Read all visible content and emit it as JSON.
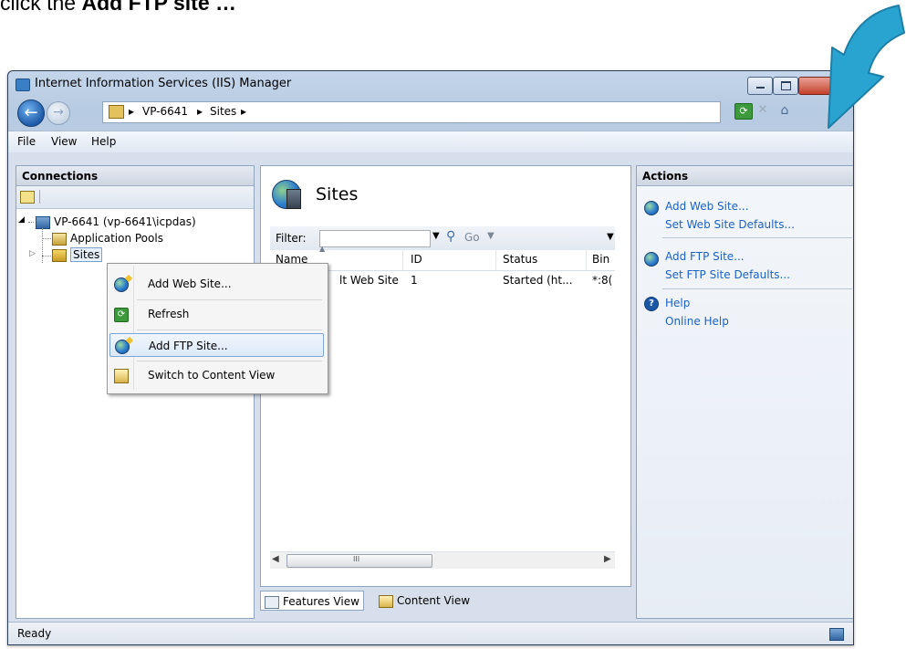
{
  "caption": {
    "prefix": "click the ",
    "bold": "Add FTP site …"
  },
  "window": {
    "title": "Internet Information Services (IIS) Manager"
  },
  "address": {
    "crumbs": [
      "VP-6641",
      "Sites"
    ],
    "sep": "▸"
  },
  "menu": {
    "file": "File",
    "view": "View",
    "help": "Help"
  },
  "connections": {
    "header": "Connections",
    "tree": {
      "server": "VP-6641 (vp-6641\\icpdas)",
      "pools": "Application Pools",
      "sites": "Sites"
    }
  },
  "center": {
    "title": "Sites",
    "filter_label": "Filter:",
    "go_label": "Go",
    "columns": [
      "Name",
      "ID",
      "Status",
      "Bin"
    ],
    "rows": [
      {
        "name": "Default Web Site",
        "visible_name": "lt Web Site",
        "id": "1",
        "status": "Started (ht...",
        "binding": "*:8("
      }
    ],
    "scroll_grip": "III"
  },
  "view_tabs": {
    "features": "Features View",
    "content": "Content View"
  },
  "actions": {
    "header": "Actions",
    "add_web_site": "Add Web Site...",
    "web_defaults": "Set Web Site Defaults...",
    "add_ftp_site": "Add FTP Site...",
    "ftp_defaults": "Set FTP Site Defaults...",
    "help": "Help",
    "online_help": "Online Help"
  },
  "context_menu": {
    "add_web_site": "Add Web Site...",
    "refresh": "Refresh",
    "add_ftp_site": "Add FTP Site...",
    "switch_content": "Switch to Content View"
  },
  "status": {
    "text": "Ready"
  },
  "colors": {
    "accent_arrow": "#29a4d1",
    "link": "#1b62c5",
    "highlight": "#dce9f8"
  }
}
